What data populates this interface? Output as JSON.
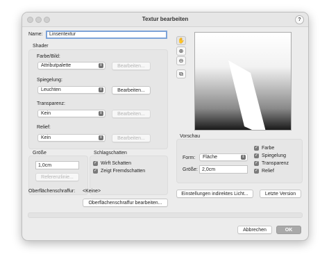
{
  "window": {
    "title": "Textur bearbeiten",
    "help": "?"
  },
  "name": {
    "label": "Name:",
    "value": "Linsentextur"
  },
  "shader": {
    "title": "Shader",
    "farbe": {
      "label": "Farbe/Bild:",
      "value": "Attributpalette",
      "button": "Bearbeiten..."
    },
    "spiegelung": {
      "label": "Spiegelung:",
      "value": "Leuchten",
      "button": "Bearbeiten..."
    },
    "transparenz": {
      "label": "Transparenz:",
      "value": "Kein",
      "button": "Bearbeiten..."
    },
    "relief": {
      "label": "Relief:",
      "value": "Kein",
      "button": "Bearbeiten..."
    }
  },
  "groesse": {
    "title": "Größe",
    "value": "1,0cm",
    "button": "Referenzlinie..."
  },
  "schlagschatten": {
    "title": "Schlagschatten",
    "wirft": {
      "label": "Wirft Schatten",
      "checked": true
    },
    "zeigt": {
      "label": "Zeigt Fremdschatten",
      "checked": true
    }
  },
  "oberflaeche": {
    "label": "Oberflächenschraffur:",
    "value": "<Keine>",
    "button": "Oberflächenschraffur bearbeiten..."
  },
  "vorschau": {
    "title": "Vorschau",
    "form_label": "Form:",
    "form_value": "Fläche",
    "groesse_label": "Größe:",
    "groesse_value": "2,0cm",
    "checks": [
      {
        "label": "Farbe",
        "checked": true
      },
      {
        "label": "Spiegelung",
        "checked": true
      },
      {
        "label": "Transparenz",
        "checked": true
      },
      {
        "label": "Relief",
        "checked": true
      }
    ]
  },
  "buttons": {
    "indirekt": "Einstellungen indirektes Licht...",
    "letzte": "Letzte Version",
    "abbrechen": "Abbrechen",
    "ok": "OK"
  },
  "icons": {
    "hand": "hand-icon",
    "zoom_in": "zoom-in-icon",
    "zoom_out": "zoom-out-icon",
    "fit": "fit-view-icon"
  }
}
